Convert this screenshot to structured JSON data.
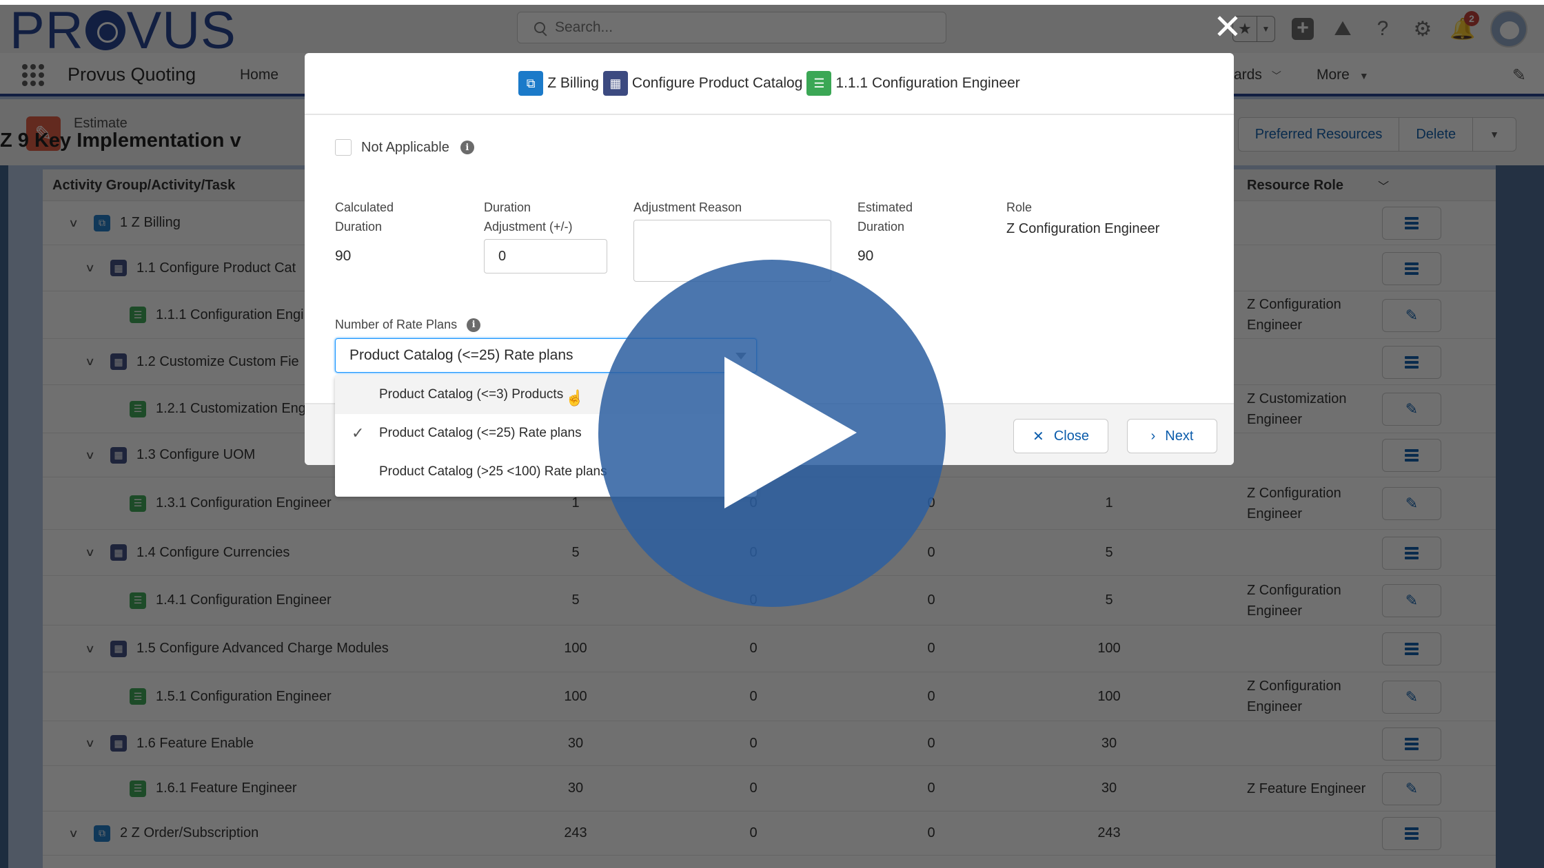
{
  "header": {
    "logo_text_left": "PR",
    "logo_text_right": "VUS",
    "search_placeholder": "Search...",
    "notification_count": "2"
  },
  "nav": {
    "app_name": "Provus Quoting",
    "items": [
      {
        "label": "Home"
      },
      {
        "label": "ards"
      },
      {
        "label": "More"
      }
    ]
  },
  "record": {
    "type": "Estimate",
    "title": "Z 9 Key Implementation v",
    "actions": [
      "Preferred Resources",
      "Delete"
    ]
  },
  "table": {
    "columns": {
      "name": "Activity Group/Activity/Task",
      "role": "Resource Role"
    },
    "rows": [
      {
        "level": 0,
        "kind": "group",
        "name": "1 Z Billing",
        "values": [
          "",
          "",
          "",
          ""
        ],
        "role": "",
        "action": "details"
      },
      {
        "level": 1,
        "kind": "activity",
        "name": "1.1 Configure Product Cat",
        "values": [
          "",
          "",
          "",
          ""
        ],
        "role": "",
        "action": "details"
      },
      {
        "level": 2,
        "kind": "task",
        "name": "1.1.1 Configuration Engi",
        "values": [
          "",
          "",
          "",
          ""
        ],
        "role": "Z Configuration Engineer",
        "action": "edit"
      },
      {
        "level": 1,
        "kind": "activity",
        "name": "1.2 Customize Custom Fie",
        "values": [
          "",
          "",
          "",
          ""
        ],
        "role": "",
        "action": "details"
      },
      {
        "level": 2,
        "kind": "task",
        "name": "1.2.1 Customization Eng",
        "values": [
          "",
          "",
          "",
          ""
        ],
        "role": "Z Customization Engineer",
        "action": "edit"
      },
      {
        "level": 1,
        "kind": "activity",
        "name": "1.3 Configure UOM",
        "values": [
          "",
          "",
          "",
          ""
        ],
        "role": "",
        "action": "details"
      },
      {
        "level": 2,
        "kind": "task",
        "name": "1.3.1 Configuration Engineer",
        "values": [
          "1",
          "0",
          "0",
          "1"
        ],
        "role": "Z Configuration Engineer",
        "action": "edit"
      },
      {
        "level": 1,
        "kind": "activity",
        "name": "1.4 Configure Currencies",
        "values": [
          "5",
          "0",
          "0",
          "5"
        ],
        "role": "",
        "action": "details"
      },
      {
        "level": 2,
        "kind": "task",
        "name": "1.4.1 Configuration Engineer",
        "values": [
          "5",
          "0",
          "0",
          "5"
        ],
        "role": "Z Configuration Engineer",
        "action": "edit"
      },
      {
        "level": 1,
        "kind": "activity",
        "name": "1.5 Configure Advanced Charge Modules",
        "values": [
          "100",
          "0",
          "0",
          "100"
        ],
        "role": "",
        "action": "details"
      },
      {
        "level": 2,
        "kind": "task",
        "name": "1.5.1 Configuration Engineer",
        "values": [
          "100",
          "0",
          "0",
          "100"
        ],
        "role": "Z Configuration Engineer",
        "action": "edit"
      },
      {
        "level": 1,
        "kind": "activity",
        "name": "1.6 Feature Enable",
        "values": [
          "30",
          "0",
          "0",
          "30"
        ],
        "role": "",
        "action": "details"
      },
      {
        "level": 2,
        "kind": "task",
        "name": "1.6.1 Feature Engineer",
        "values": [
          "30",
          "0",
          "0",
          "30"
        ],
        "role": "Z Feature Engineer",
        "action": "edit"
      },
      {
        "level": 0,
        "kind": "group",
        "name": "2 Z Order/Subscription",
        "values": [
          "243",
          "0",
          "0",
          "243"
        ],
        "role": "",
        "action": "details"
      }
    ]
  },
  "modal": {
    "breadcrumb": [
      {
        "label": "Z Billing",
        "kind": "group"
      },
      {
        "label": "Configure Product Catalog",
        "kind": "activity"
      },
      {
        "label": "1.1.1 Configuration Engineer",
        "kind": "task"
      }
    ],
    "not_applicable_label": "Not Applicable",
    "not_applicable_checked": false,
    "calculated_duration_label_1": "Calculated",
    "calculated_duration_label_2": "Duration",
    "calculated_duration": "90",
    "duration_adjustment_label_1": "Duration",
    "duration_adjustment_label_2": "Adjustment (+/-)",
    "duration_adjustment": "0",
    "adjustment_reason_label": "Adjustment Reason",
    "adjustment_reason": "",
    "estimated_duration_label_1": "Estimated",
    "estimated_duration_label_2": "Duration",
    "estimated_duration": "90",
    "role_label": "Role",
    "role": "Z Configuration Engineer",
    "rate_plans_label": "Number of Rate Plans",
    "rate_plans_selected": "Product Catalog (<=25) Rate plans",
    "rate_plans_options": [
      {
        "label": "Product Catalog (<=3) Products",
        "selected": false,
        "hovered": true
      },
      {
        "label": "Product Catalog (<=25) Rate plans",
        "selected": true,
        "hovered": false
      },
      {
        "label": "Product Catalog (>25 <100) Rate plans",
        "selected": false,
        "hovered": false
      }
    ],
    "close_label": "Close",
    "next_label": "Next"
  },
  "video": {
    "overlay": "play-button"
  },
  "colors": {
    "brand": "#1f3f8f",
    "link": "#0b5cab",
    "group_icon": "#1b7ac9",
    "activity_icon": "#3c4a80",
    "task_icon": "#3ba755",
    "estimate_icon": "#e0593e",
    "play_button": "#2c5ea0"
  }
}
